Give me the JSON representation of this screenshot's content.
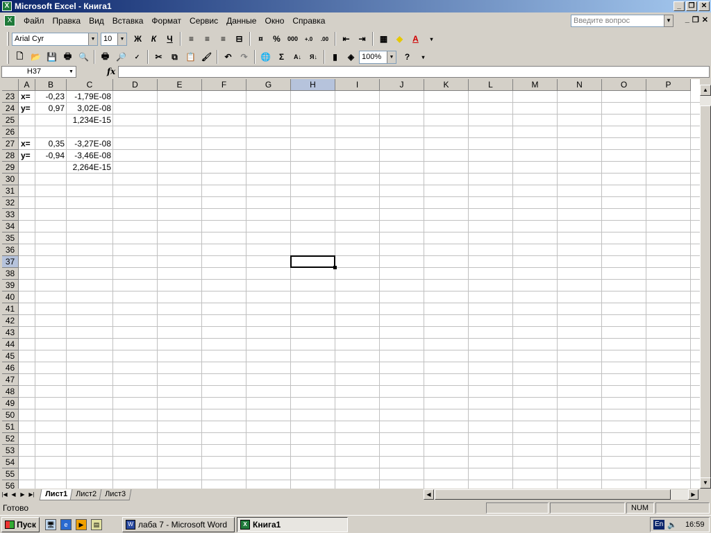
{
  "window": {
    "title": "Microsoft Excel - Книга1",
    "app_icon": "excel-icon"
  },
  "menu": [
    "Файл",
    "Правка",
    "Вид",
    "Вставка",
    "Формат",
    "Сервис",
    "Данные",
    "Окно",
    "Справка"
  ],
  "ask_placeholder": "Введите вопрос",
  "format_toolbar": {
    "font": "Arial Cyr",
    "size": "10",
    "bold": "Ж",
    "italic": "К",
    "underline": "Ч",
    "percent": "%",
    "thousands": "000"
  },
  "std_toolbar": {
    "zoom": "100%",
    "sum": "Σ"
  },
  "formula_bar": {
    "name_box": "H37",
    "fx": "fx",
    "value": ""
  },
  "columns": [
    "A",
    "B",
    "C",
    "D",
    "E",
    "F",
    "G",
    "H",
    "I",
    "J",
    "K",
    "L",
    "M",
    "N",
    "O",
    "P"
  ],
  "first_row": 23,
  "last_row": 56,
  "active_cell": "H37",
  "cells": [
    {
      "row": 23,
      "col": "A",
      "text": "x=",
      "bold": true
    },
    {
      "row": 23,
      "col": "B",
      "text": "-0,23"
    },
    {
      "row": 23,
      "col": "C",
      "text": "-1,79E-08"
    },
    {
      "row": 24,
      "col": "A",
      "text": "y=",
      "bold": true
    },
    {
      "row": 24,
      "col": "B",
      "text": "0,97"
    },
    {
      "row": 24,
      "col": "C",
      "text": "3,02E-08"
    },
    {
      "row": 25,
      "col": "C",
      "text": "1,234E-15"
    },
    {
      "row": 27,
      "col": "A",
      "text": "x=",
      "bold": true
    },
    {
      "row": 27,
      "col": "B",
      "text": "0,35"
    },
    {
      "row": 27,
      "col": "C",
      "text": "-3,27E-08"
    },
    {
      "row": 28,
      "col": "A",
      "text": "y=",
      "bold": true
    },
    {
      "row": 28,
      "col": "B",
      "text": "-0,94"
    },
    {
      "row": 28,
      "col": "C",
      "text": "-3,46E-08"
    },
    {
      "row": 29,
      "col": "C",
      "text": "2,264E-15"
    }
  ],
  "sheets": [
    {
      "name": "Лист1",
      "active": true
    },
    {
      "name": "Лист2",
      "active": false
    },
    {
      "name": "Лист3",
      "active": false
    }
  ],
  "status": {
    "text": "Готово",
    "num": "NUM"
  },
  "taskbar": {
    "start": "Пуск",
    "tasks": [
      {
        "label": "лаба 7 - Microsoft Word",
        "icon": "word-icon",
        "active": false
      },
      {
        "label": "Книга1",
        "icon": "excel-icon",
        "active": true
      }
    ],
    "lang": "En",
    "clock": "16:59"
  }
}
